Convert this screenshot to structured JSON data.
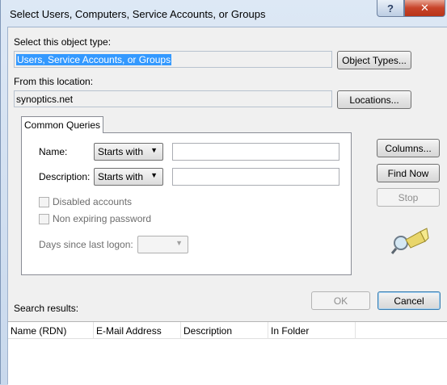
{
  "window": {
    "title": "Select Users, Computers, Service Accounts, or Groups",
    "help_glyph": "?",
    "close_glyph": "✕"
  },
  "object_type": {
    "label": "Select this object type:",
    "value": "Users, Service Accounts, or Groups",
    "button": "Object Types..."
  },
  "location": {
    "label": "From this location:",
    "value": "synoptics.net",
    "button": "Locations..."
  },
  "tabs": [
    {
      "label": "Common Queries"
    }
  ],
  "queries": {
    "name_label": "Name:",
    "name_mode": "Starts with",
    "name_value": "",
    "description_label": "Description:",
    "description_mode": "Starts with",
    "description_value": "",
    "disabled_accounts": {
      "label": "Disabled accounts",
      "checked": false
    },
    "non_expiring": {
      "label": "Non expiring password",
      "checked": false
    },
    "days_label": "Days since last logon:",
    "days_value": "",
    "combo_arrow": "▼"
  },
  "side_buttons": {
    "columns": "Columns...",
    "find_now": "Find Now",
    "stop": "Stop"
  },
  "dialog_buttons": {
    "ok": "OK",
    "cancel": "Cancel"
  },
  "results": {
    "label": "Search results:",
    "columns": [
      "Name (RDN)",
      "E-Mail Address",
      "Description",
      "In Folder"
    ]
  },
  "icons": {
    "search": "magnifier-flashlight-icon"
  },
  "colors": {
    "selection": "#3399ff",
    "close_button": "#c8452b"
  }
}
